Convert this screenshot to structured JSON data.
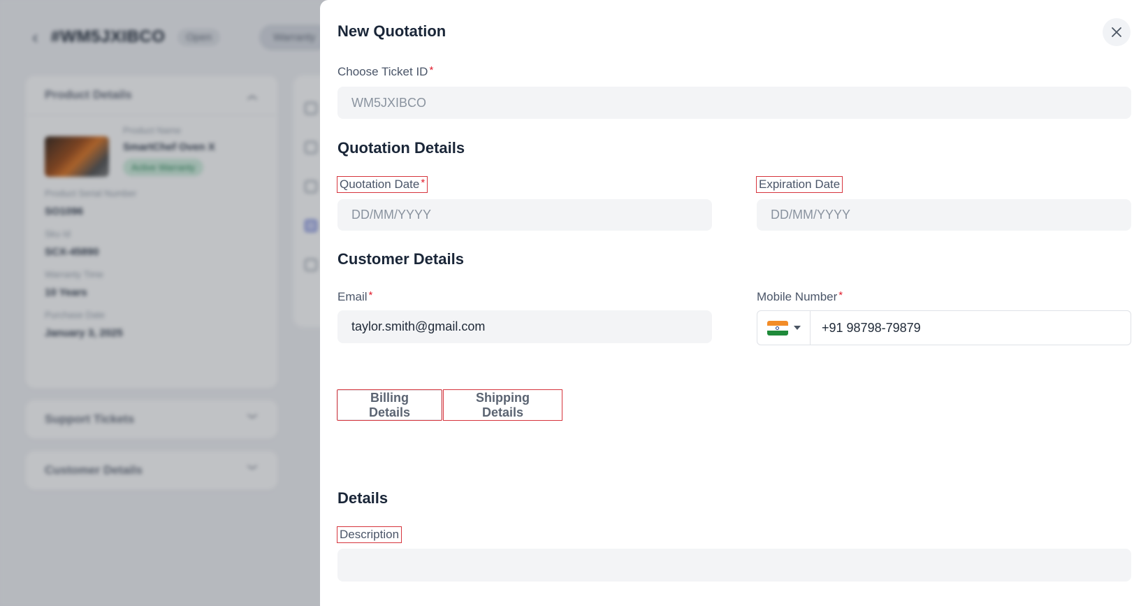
{
  "background": {
    "ticket_id": "#WM5JXIBCO",
    "status": "Open",
    "tab_label": "Warranty",
    "product_card": {
      "title": "Product Details",
      "product_name_label": "Product Name",
      "product_name": "SmartChef Oven X",
      "warranty_badge": "Active Warranty",
      "serial_label": "Product Serial Number",
      "serial": "SO1096",
      "sku_label": "Sku Id",
      "sku": "SCX-45890",
      "warranty_time_label": "Warranty Time",
      "warranty_time": "10 Years",
      "purchase_date_label": "Purchase Date",
      "purchase_date": "January 3, 2025"
    },
    "support_tickets_title": "Support Tickets",
    "customer_details_title": "Customer Details"
  },
  "drawer": {
    "title": "New Quotation",
    "ticket_label": "Choose Ticket ID",
    "ticket_value": "WM5JXIBCO",
    "quotation_section": "Quotation Details",
    "quotation_date_label": "Quotation Date",
    "quotation_date_placeholder": "DD/MM/YYYY",
    "expiration_date_label": "Expiration Date",
    "expiration_date_placeholder": "DD/MM/YYYY",
    "customer_section": "Customer Details",
    "email_label": "Email",
    "email_value": "taylor.smith@gmail.com",
    "mobile_label": "Mobile Number",
    "mobile_value": "+91 98798-79879",
    "tabs": [
      "Billing Details",
      "Shipping Details"
    ],
    "details_section": "Details",
    "description_label": "Description",
    "description_value": ""
  },
  "required_marker": "*",
  "colors": {
    "required": "#e11d2d",
    "highlight_box": "#d6343c",
    "input_bg": "#f3f4f6",
    "title": "#1a2638"
  },
  "icons": {
    "close": "close-icon",
    "back": "chevron-left-icon",
    "flag": "india-flag-icon",
    "dropdown": "caret-down-icon"
  }
}
